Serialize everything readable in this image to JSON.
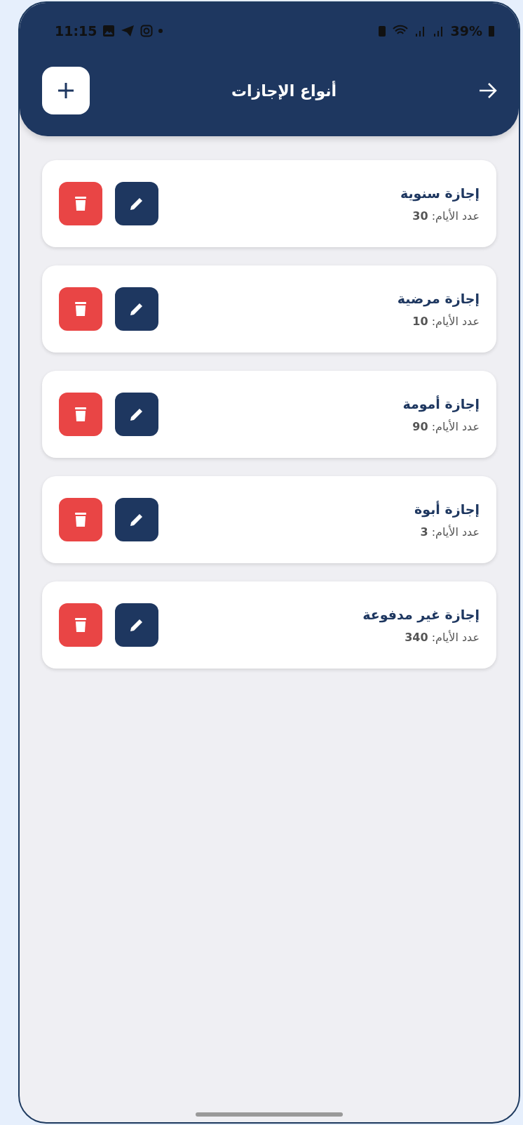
{
  "status_bar": {
    "time": "11:15",
    "battery": "39%"
  },
  "header": {
    "title": "أنواع الإجازات"
  },
  "leave_types": [
    {
      "name": "إجازة سنوية",
      "days": "عدد الأيام: **30**"
    },
    {
      "name": "إجازة مرضية",
      "days": "عدد الأيام: **10**"
    },
    {
      "name": "إجازة أمومة",
      "days": "عدد الأيام: **90**"
    },
    {
      "name": "إجازة أبوة",
      "days": "عدد الأيام: **3**"
    },
    {
      "name": "إجازة غير مدفوعة",
      "days": "عدد الأيام: **340**"
    }
  ]
}
